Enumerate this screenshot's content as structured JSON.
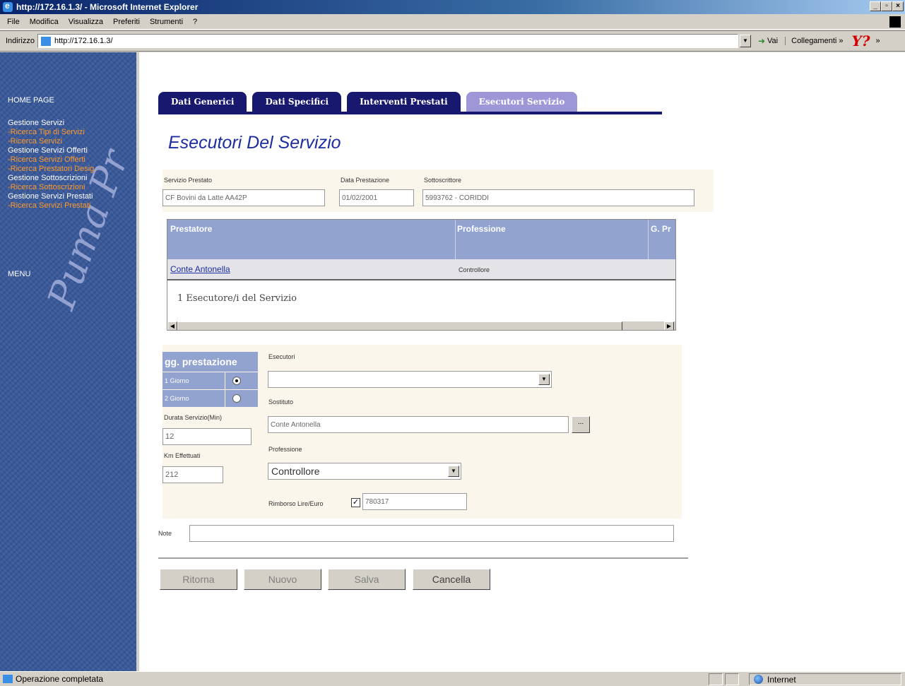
{
  "window": {
    "title": "http://172.16.1.3/ - Microsoft Internet Explorer"
  },
  "menu": [
    "File",
    "Modifica",
    "Visualizza",
    "Preferiti",
    "Strumenti",
    "?"
  ],
  "address": {
    "label": "Indirizzo",
    "url": "http://172.16.1.3/",
    "go": "Vai",
    "links": "Collegamenti",
    "links_chev": "»",
    "more": "»"
  },
  "sidebar": {
    "home": "HOME PAGE",
    "items": [
      {
        "label": "Gestione Servizi",
        "type": "h"
      },
      {
        "label": "-Ricerca Tipi di Servizi",
        "type": "l"
      },
      {
        "label": "-Ricerca Servizi",
        "type": "l"
      },
      {
        "label": "Gestione Servizi Offerti",
        "type": "h"
      },
      {
        "label": "-Ricerca Servizi Offerti",
        "type": "l"
      },
      {
        "label": "-Ricerca Prestatori Desig.",
        "type": "l"
      },
      {
        "label": "Gestione Sottoscrizioni",
        "type": "h"
      },
      {
        "label": "-Ricerca Sottoscrizioni",
        "type": "l"
      },
      {
        "label": "Gestione Servizi Prestati",
        "type": "h"
      },
      {
        "label": "-Ricerca Servizi Prestati",
        "type": "l"
      }
    ],
    "menu": "MENU",
    "watermark": "Puma Pr"
  },
  "tabs": [
    "Dati Generici",
    "Dati Specifici",
    "Interventi Prestati",
    "Esecutori Servizio"
  ],
  "page_title": "Esecutori Del Servizio",
  "fields": {
    "servizio_label": "Servizio Prestato",
    "servizio_value": "CF Bovini da Latte AA42P",
    "data_label": "Data Prestazione",
    "data_value": "01/02/2001",
    "sottoscrittore_label": "Sottoscrittore",
    "sottoscrittore_value": "5993762 - CORIDDI"
  },
  "grid": {
    "headers": [
      "Prestatore",
      "Professione",
      "G. Pr"
    ],
    "rows": [
      {
        "prestatore": "Conte Antonella",
        "professione": "Controllore"
      }
    ],
    "footer": "1 Esecutore/i del Servizio"
  },
  "detail": {
    "gg_header": "gg. prestazione",
    "gg_options": [
      "1 Giorno",
      "2 Giorno"
    ],
    "durata_label": "Durata Servizio(Min)",
    "durata_value": "12",
    "km_label": "Km Effettuati",
    "km_value": "212",
    "esecutori_label": "Esecutori",
    "esecutori_value": "",
    "sostituto_label": "Sostituto",
    "sostituto_value": "Conte Antonella",
    "browse": "...",
    "professione_label": "Professione",
    "professione_value": "Controllore",
    "rimborso_label": "Rimborso Lire/Euro",
    "rimborso_value": "780317",
    "note_label": "Note",
    "note_value": ""
  },
  "buttons": [
    "Ritorna",
    "Nuovo",
    "Salva",
    "Cancella"
  ],
  "status": {
    "text": "Operazione completata",
    "zone": "Internet"
  }
}
